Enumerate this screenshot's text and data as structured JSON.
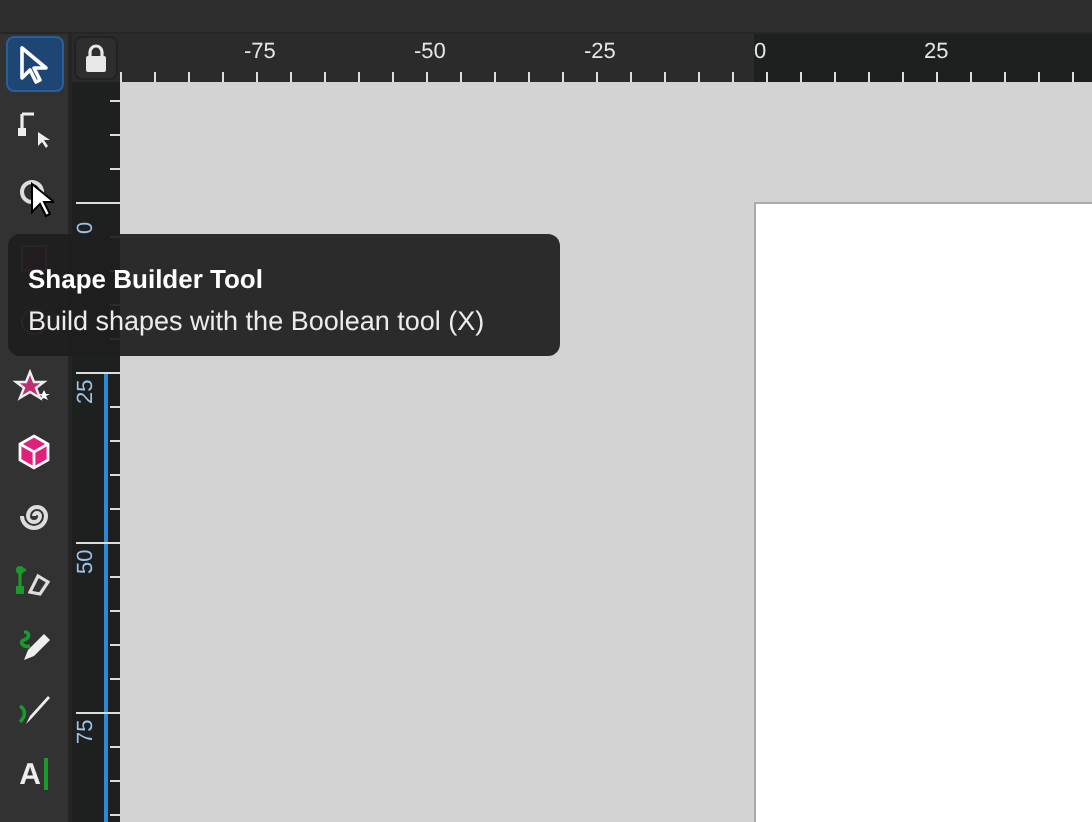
{
  "tools": [
    {
      "kind": "select",
      "selected": true
    },
    {
      "kind": "node",
      "selected": false
    },
    {
      "kind": "shape-builder",
      "selected": false
    },
    {
      "kind": "rectangle",
      "selected": false
    },
    {
      "kind": "ellipse",
      "selected": false
    },
    {
      "kind": "star",
      "selected": false
    },
    {
      "kind": "box3d",
      "selected": false
    },
    {
      "kind": "spiral",
      "selected": false
    },
    {
      "kind": "pen",
      "selected": false
    },
    {
      "kind": "pencil",
      "selected": false
    },
    {
      "kind": "calligraphy",
      "selected": false
    },
    {
      "kind": "text",
      "selected": false,
      "label": "A"
    }
  ],
  "horizontal_ruler": {
    "labels": [
      "-75",
      "-50",
      "-25",
      "0",
      "25"
    ]
  },
  "vertical_ruler": {
    "labels": [
      "0",
      "25",
      "50",
      "75"
    ]
  },
  "tooltip": {
    "title": "Shape Builder Tool",
    "description": "Build shapes with the Boolean tool (X)"
  }
}
